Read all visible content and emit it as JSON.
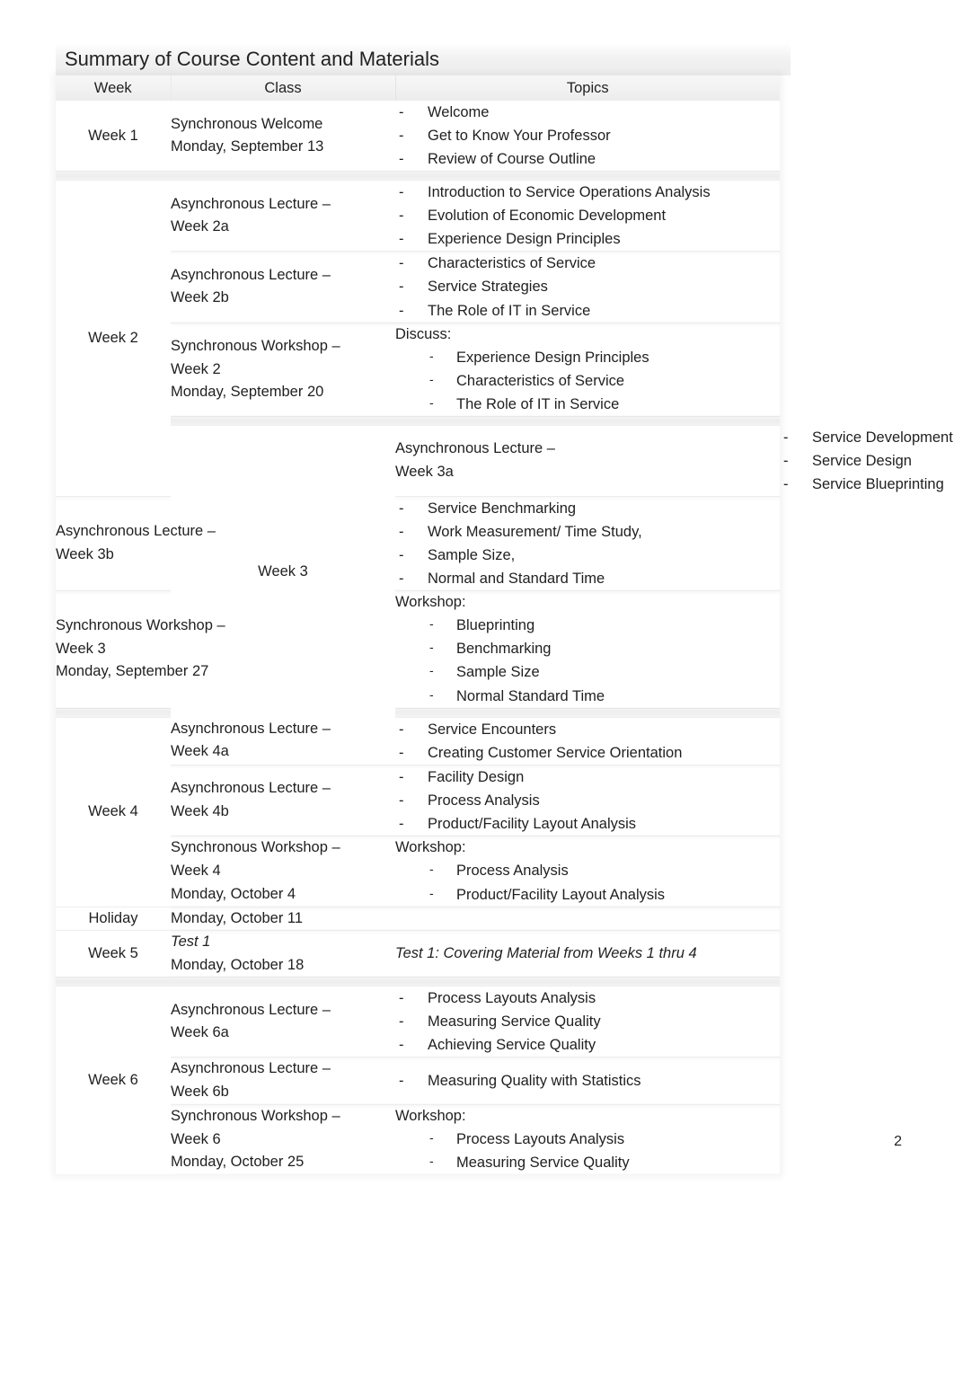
{
  "document": {
    "title": "Summary of Course Content and Materials",
    "page_number": "2"
  },
  "table": {
    "headers": {
      "week": "Week",
      "class": "Class",
      "topics": "Topics"
    },
    "weeks": {
      "w1": "Week 1",
      "w2": "Week 2",
      "w3": "Week 3",
      "w4": "Week 4",
      "holiday": "Holiday",
      "w5": "Week 5",
      "w6": "Week 6"
    },
    "rows": {
      "r1": {
        "class_l1": "Synchronous Welcome",
        "class_l2": "Monday, September 13",
        "topics": [
          "Welcome",
          "Get to Know Your Professor",
          "Review of Course Outline"
        ]
      },
      "r2a": {
        "class_l1": "Asynchronous Lecture –",
        "class_l2": "Week 2a",
        "topics": [
          "Introduction to Service Operations Analysis",
          "Evolution of Economic Development",
          "Experience Design Principles"
        ]
      },
      "r2b": {
        "class_l1": "Asynchronous Lecture –",
        "class_l2": "Week 2b",
        "topics": [
          "Characteristics of Service",
          "Service Strategies",
          "The Role of IT in Service"
        ]
      },
      "r2w": {
        "class_l1": "Synchronous Workshop –",
        "class_l2": "Week 2",
        "class_l3": "Monday, September 20",
        "lead": "Discuss:",
        "topics": [
          "Experience Design Principles",
          "Characteristics of Service",
          "The Role of IT in Service"
        ]
      },
      "r3a": {
        "class_l1": "Asynchronous Lecture –",
        "class_l2": "Week 3a",
        "topics": [
          "Service Development",
          "Service Design",
          "Service Blueprinting"
        ]
      },
      "r3b": {
        "class_l1": "Asynchronous Lecture –",
        "class_l2": "Week 3b",
        "topics": [
          "Service Benchmarking",
          "Work Measurement/ Time Study,",
          "Sample Size,",
          "Normal and Standard Time"
        ]
      },
      "r3w": {
        "class_l1": "Synchronous Workshop –",
        "class_l2": "Week 3",
        "class_l3": "Monday, September 27",
        "lead": "Workshop:",
        "topics": [
          "Blueprinting",
          "Benchmarking",
          "Sample Size",
          "Normal Standard Time"
        ]
      },
      "r4a": {
        "class_l1": "Asynchronous Lecture –",
        "class_l2": "Week 4a",
        "topics": [
          "Service Encounters",
          "Creating Customer Service Orientation"
        ]
      },
      "r4b": {
        "class_l1": "Asynchronous Lecture –",
        "class_l2": "Week 4b",
        "topics": [
          "Facility Design",
          "Process Analysis",
          "Product/Facility Layout Analysis"
        ]
      },
      "r4w": {
        "class_l1": "Synchronous Workshop –",
        "class_l2": "Week 4",
        "class_l3": "Monday, October 4",
        "lead": "Workshop:",
        "topics": [
          "Process Analysis",
          "Product/Facility Layout Analysis"
        ]
      },
      "rholiday": {
        "class_l1": "Monday, October 11",
        "topics": []
      },
      "r5": {
        "class_l1": "Test 1",
        "class_l2": "Monday, October 18",
        "topic_note": "Test 1: Covering Material from Weeks 1 thru 4"
      },
      "r6a": {
        "class_l1": "Asynchronous Lecture –",
        "class_l2": "Week 6a",
        "topics": [
          "Process Layouts Analysis",
          "Measuring Service Quality",
          "Achieving Service Quality"
        ]
      },
      "r6b": {
        "class_l1": "Asynchronous Lecture –",
        "class_l2": "Week 6b",
        "topics": [
          "Measuring Quality with Statistics"
        ]
      },
      "r6w": {
        "class_l1": "Synchronous Workshop –",
        "class_l2": "Week 6",
        "class_l3": "Monday, October 25",
        "lead": "Workshop:",
        "topics": [
          "Process Layouts Analysis",
          "Measuring Service Quality"
        ]
      }
    }
  }
}
